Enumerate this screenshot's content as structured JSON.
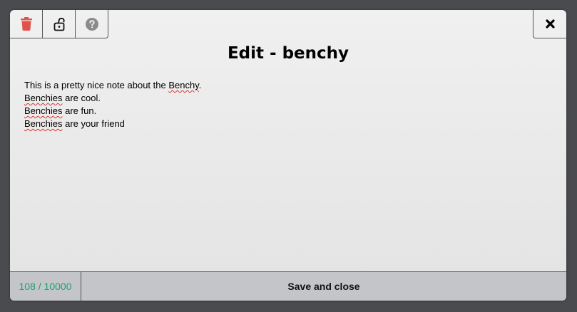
{
  "dialog": {
    "title": "Edit - benchy",
    "note_lines": [
      {
        "parts": [
          {
            "text": "This is a pretty nice note about the "
          },
          {
            "text": "Benchy",
            "spell": true
          },
          {
            "text": "."
          }
        ]
      },
      {
        "parts": [
          {
            "text": "Benchies",
            "spell": true
          },
          {
            "text": " are cool."
          }
        ]
      },
      {
        "parts": [
          {
            "text": "Benchies",
            "spell": true
          },
          {
            "text": " are fun."
          }
        ]
      },
      {
        "parts": [
          {
            "text": "Benchies",
            "spell": true
          },
          {
            "text": " are your friend"
          }
        ]
      }
    ],
    "char_count": "108 / 10000",
    "save_label": "Save and close"
  },
  "toolbar": {
    "buttons": [
      {
        "icon": "trash-icon",
        "color": "#e0524a"
      },
      {
        "icon": "unlock-icon",
        "color": "#111111"
      },
      {
        "icon": "help-icon",
        "color": "#8a8a8a"
      }
    ],
    "close_icon": "close-icon"
  },
  "colors": {
    "counter": "#1aa36a",
    "delete": "#e0524a"
  }
}
